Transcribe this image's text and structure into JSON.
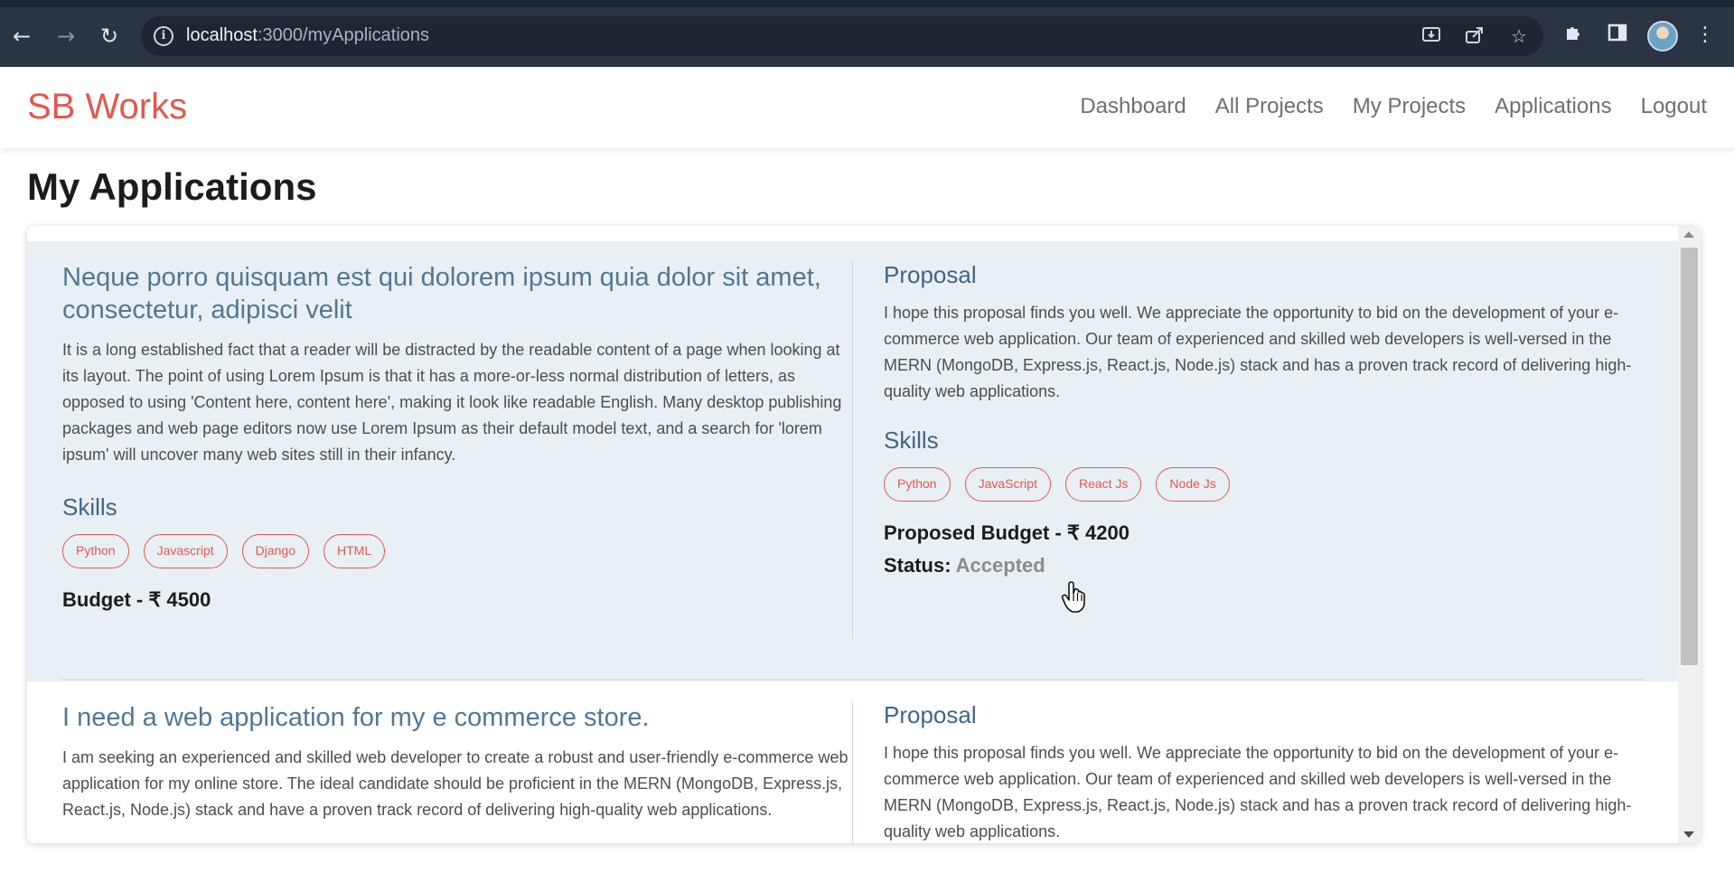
{
  "browser": {
    "url_host": "localhost",
    "url_path": ":3000/myApplications",
    "icons": {
      "back": "back-arrow-icon",
      "forward": "forward-arrow-icon",
      "reload": "reload-icon",
      "info": "site-info-icon",
      "install": "install-app-icon",
      "share": "share-icon",
      "bookmark": "bookmark-star-icon",
      "extensions": "puzzle-extensions-icon",
      "sidepanel": "side-panel-icon",
      "menu": "kebab-menu-icon"
    }
  },
  "header": {
    "logo": "SB Works",
    "nav": [
      "Dashboard",
      "All Projects",
      "My Projects",
      "Applications",
      "Logout"
    ]
  },
  "page": {
    "title": "My Applications"
  },
  "applications": [
    {
      "title": "Neque porro quisquam est qui dolorem ipsum quia dolor sit amet, consectetur, adipisci velit",
      "description": "It is a long established fact that a reader will be distracted by the readable content of a page when looking at its layout. The point of using Lorem Ipsum is that it has a more-or-less normal distribution of letters, as opposed to using 'Content here, content here', making it look like readable English. Many desktop publishing packages and web page editors now use Lorem Ipsum as their default model text, and a search for 'lorem ipsum' will uncover many web sites still in their infancy.",
      "skills_heading": "Skills",
      "skills": [
        "Python",
        "Javascript",
        "Django",
        "HTML"
      ],
      "budget": "Budget - ₹ 4500",
      "proposal_heading": "Proposal",
      "proposal": "I hope this proposal finds you well. We appreciate the opportunity to bid on the development of your e-commerce web application. Our team of experienced and skilled web developers is well-versed in the MERN (MongoDB, Express.js, React.js, Node.js) stack and has a proven track record of delivering high-quality web applications.",
      "proposal_skills_heading": "Skills",
      "proposal_skills": [
        "Python",
        "JavaScript",
        "React Js",
        "Node Js"
      ],
      "proposed_budget": "Proposed Budget - ₹ 4200",
      "status_label": "Status:",
      "status_value": "Accepted"
    },
    {
      "title": "I need a web application for my e commerce store.",
      "description": "I am seeking an experienced and skilled web developer to create a robust and user-friendly e-commerce web application for my online store. The ideal candidate should be proficient in the MERN (MongoDB, Express.js, React.js, Node.js) stack and have a proven track record of delivering high-quality web applications.",
      "proposal_heading": "Proposal",
      "proposal": "I hope this proposal finds you well. We appreciate the opportunity to bid on the development of your e-commerce web application. Our team of experienced and skilled web developers is well-versed in the MERN (MongoDB, Express.js, React.js, Node.js) stack and has a proven track record of delivering high-quality web applications."
    }
  ],
  "colors": {
    "brand": "#e0594f",
    "title_blue": "#4f7896",
    "active_card_bg": "#e9f0f5"
  }
}
